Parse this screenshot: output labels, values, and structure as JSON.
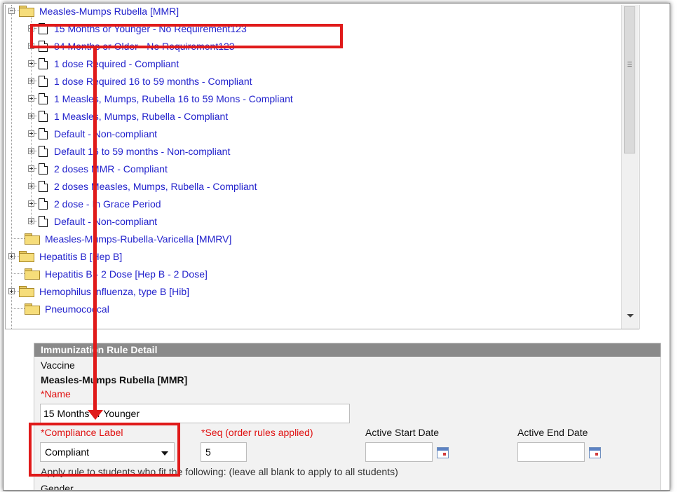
{
  "tree": {
    "rows": [
      {
        "label": "Measles-Mumps Rubella [MMR]",
        "type": "folder",
        "indent": 0,
        "expander": "minus"
      },
      {
        "label": "15 Months or Younger - No Requirement123",
        "type": "rule",
        "indent": 1,
        "expander": "plus"
      },
      {
        "label": "84 Months or Older - No Requirement123",
        "type": "rule",
        "indent": 1,
        "expander": "plus"
      },
      {
        "label": "1 dose Required - Compliant",
        "type": "rule",
        "indent": 1,
        "expander": "plus"
      },
      {
        "label": "1 dose Required 16 to 59 months - Compliant",
        "type": "rule",
        "indent": 1,
        "expander": "plus"
      },
      {
        "label": "1 Measles, Mumps, Rubella 16 to 59 Mons - Compliant",
        "type": "rule",
        "indent": 1,
        "expander": "plus"
      },
      {
        "label": "1 Measles, Mumps, Rubella - Compliant",
        "type": "rule",
        "indent": 1,
        "expander": "plus"
      },
      {
        "label": "Default - Non-compliant",
        "type": "rule",
        "indent": 1,
        "expander": "plus"
      },
      {
        "label": "Default 16 to 59 months - Non-compliant",
        "type": "rule",
        "indent": 1,
        "expander": "plus"
      },
      {
        "label": "2 doses MMR - Compliant",
        "type": "rule",
        "indent": 1,
        "expander": "plus"
      },
      {
        "label": "2 doses Measles, Mumps, Rubella - Compliant",
        "type": "rule",
        "indent": 1,
        "expander": "plus"
      },
      {
        "label": "2 dose - In Grace Period",
        "type": "rule",
        "indent": 1,
        "expander": "plus"
      },
      {
        "label": "Default - Non-compliant",
        "type": "rule",
        "indent": 1,
        "expander": "plus"
      },
      {
        "label": "Measles-Mumps-Rubella-Varicella [MMRV]",
        "type": "folder",
        "indent": 0,
        "expander": "none"
      },
      {
        "label": "Hepatitis B [Hep B]",
        "type": "folder",
        "indent": 0,
        "expander": "plus"
      },
      {
        "label": "Hepatitis B - 2 Dose [Hep B - 2 Dose]",
        "type": "folder",
        "indent": 0,
        "expander": "none"
      },
      {
        "label": "Hemophilus influenza, type B [Hib]",
        "type": "folder",
        "indent": 0,
        "expander": "plus"
      },
      {
        "label": "Pneumococcal",
        "type": "folder",
        "indent": 0,
        "expander": "none"
      }
    ]
  },
  "detail": {
    "header": "Immunization Rule Detail",
    "vaccine_label": "Vaccine",
    "vaccine_value": "Measles-Mumps Rubella [MMR]",
    "name_label": "*Name",
    "name_value": "15 Months or Younger",
    "compliance_label": "*Compliance Label",
    "compliance_value": "Compliant",
    "seq_label": "*Seq (order rules applied)",
    "seq_value": "5",
    "active_start_label": "Active Start Date",
    "active_start_value": "",
    "active_end_label": "Active End Date",
    "active_end_value": "",
    "apply_text": "Apply rule to students who fit the following: (leave all blank to apply to all students)",
    "gender_label": "Gender"
  },
  "colors": {
    "tree_link": "#2222cc",
    "required": "#e01010",
    "header_bg": "#8a8a8a",
    "annotation": "#e01a1a"
  }
}
